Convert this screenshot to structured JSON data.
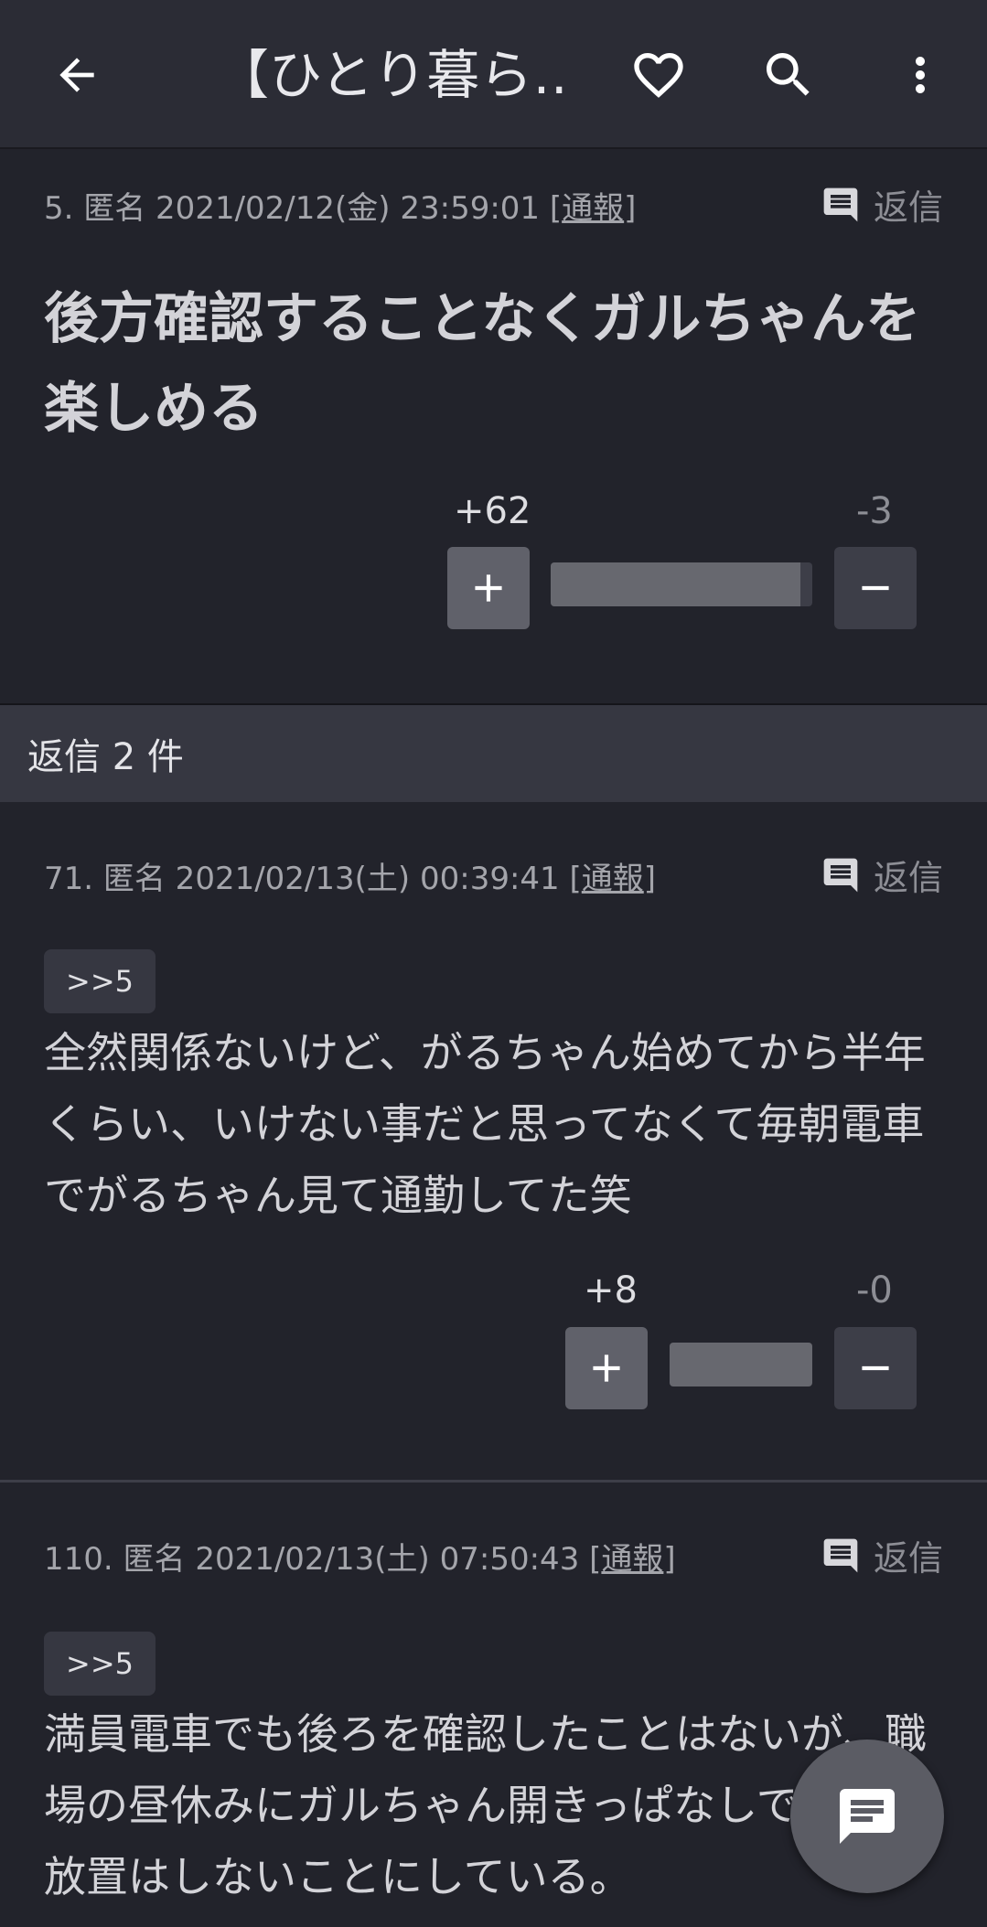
{
  "appbar": {
    "title": "【ひとり暮ら…",
    "icons": [
      "arrow-back-icon",
      "heart-outline-icon",
      "search-icon",
      "more-vert-icon"
    ]
  },
  "posts": [
    {
      "meta": "5. 匿名 2021/02/12(金) 23:59:01 [",
      "report": "通報",
      "meta_close": "]",
      "reply": "返信",
      "anchor": "",
      "body": "後方確認することなくガルちゃんを楽しめる",
      "plus": "+62",
      "minus": "-3",
      "plus_ratio": 0.954
    },
    {
      "meta": "71. 匿名 2021/02/13(土) 00:39:41 [",
      "report": "通報",
      "meta_close": "]",
      "reply": "返信",
      "anchor": ">>5",
      "body": "全然関係ないけど、がるちゃん始めてから半年くらい、いけない事だと思ってなくて毎朝電車でがるちゃん見て通勤してた笑",
      "plus": "+8",
      "minus": "-0",
      "plus_ratio": 1.0
    },
    {
      "meta": "110. 匿名 2021/02/13(土) 07:50:43 [",
      "report": "通報",
      "meta_close": "]",
      "reply": "返信",
      "anchor": ">>5",
      "body": "満員電車でも後ろを確認したことはないが、職場の昼休みにガルちゃん開きっぱなしでスマホ放置はしないことにしている。"
    }
  ],
  "replies_header": "返信 2 件",
  "colors": {
    "background": "#22232b",
    "appbar": "#2b2c35",
    "section": "#363741",
    "fab": "#5b5c64"
  }
}
